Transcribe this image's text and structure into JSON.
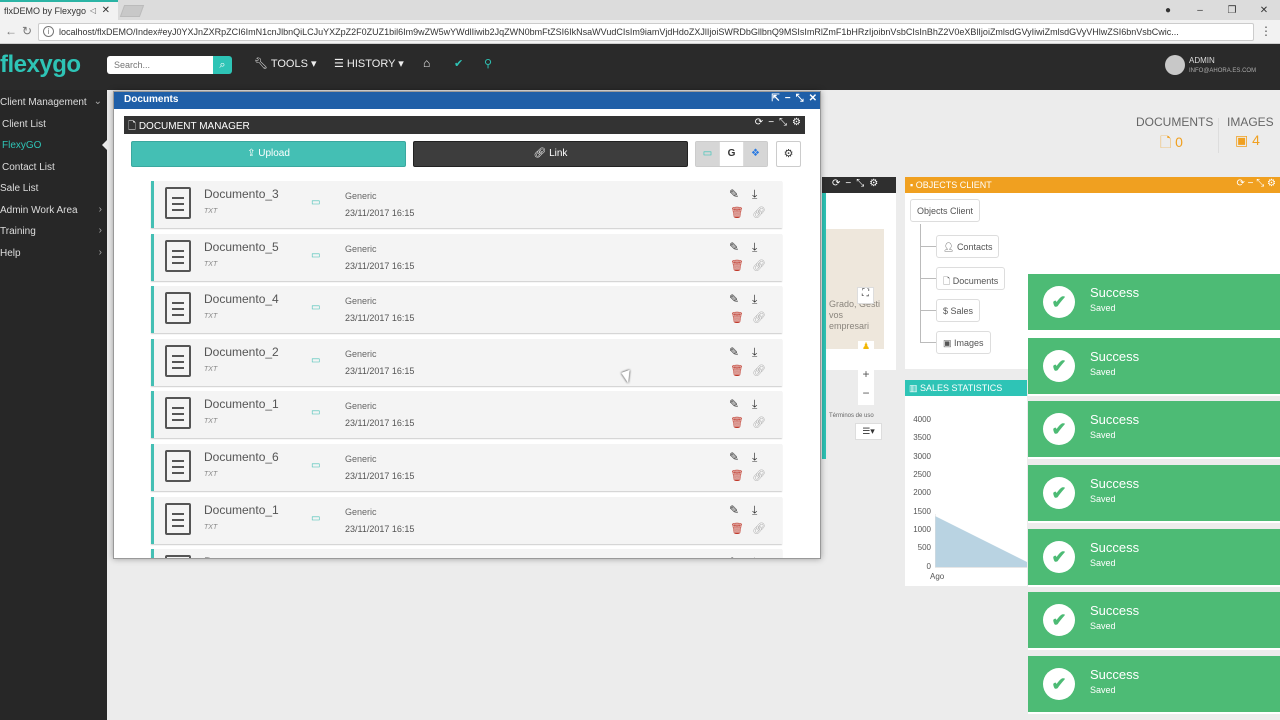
{
  "browser": {
    "tab_title": "flxDEMO by Flexygo",
    "url": "localhost/flxDEMO/Index#eyJ0YXJnZXRpZCI6ImN1cnJlbnQiLCJuYXZpZ2F0ZUZ1bil6Im9wZW5wYWdlIiwib2JqZWN0bmFtZSI6IkNsaWVudCIsIm9iamVjdHdoZXJlIjoiSWRDbGllbnQ9MSIsImRlZmF1bHRzIjoibnVsbCIsInBhZ2V0eXBlIjoiZmlsdGVyIiwiZmlsdGVyVHlwZSI6bnVsbCwic..."
  },
  "topbar": {
    "logo": "flexygo",
    "search_placeholder": "Search...",
    "tools_label": "TOOLS ▾",
    "history_label": "HISTORY ▾",
    "admin_name": "ADMIN",
    "admin_email": "INFO@AHORA.ES.COM"
  },
  "sidebar": {
    "items": [
      {
        "label": "Client Management"
      },
      {
        "label": "Client List"
      },
      {
        "label": "FlexyGO"
      },
      {
        "label": "Contact List"
      },
      {
        "label": "Sale List"
      },
      {
        "label": "Admin Work Area"
      },
      {
        "label": "Training"
      },
      {
        "label": "Help"
      }
    ]
  },
  "counters": {
    "documents_label": "DOCUMENTS",
    "documents_count": "0",
    "images_label": "IMAGES",
    "images_count": "4"
  },
  "map": {
    "text": "Grado, Gesti vos empresari",
    "terms": "Términos de uso"
  },
  "objects_client": {
    "title": "OBJECTS CLIENT",
    "root": "Objects Client",
    "children": [
      {
        "label": "Contacts"
      },
      {
        "label": "Documents"
      },
      {
        "label": "Sales"
      },
      {
        "label": "Images"
      }
    ]
  },
  "sales_statistics": {
    "title": "SALES STATISTICS",
    "y_ticks": [
      "4000",
      "3500",
      "3000",
      "2500",
      "2000",
      "1500",
      "1000",
      "500",
      "0"
    ],
    "x_label": "Ago"
  },
  "toasts": [
    {
      "title": "Success",
      "message": "Saved"
    },
    {
      "title": "Success",
      "message": "Saved"
    },
    {
      "title": "Success",
      "message": "Saved"
    },
    {
      "title": "Success",
      "message": "Saved"
    },
    {
      "title": "Success",
      "message": "Saved"
    },
    {
      "title": "Success",
      "message": "Saved"
    },
    {
      "title": "Success",
      "message": "Saved"
    }
  ],
  "modal": {
    "title": "Documents",
    "manager_title": "DOCUMENT MANAGER",
    "upload_label": "Upload",
    "link_label": "Link",
    "google_label": "G",
    "documents": [
      {
        "name": "Documento_3",
        "ext": "TXT",
        "category": "Generic",
        "date": "23/11/2017 16:15"
      },
      {
        "name": "Documento_5",
        "ext": "TXT",
        "category": "Generic",
        "date": "23/11/2017 16:15"
      },
      {
        "name": "Documento_4",
        "ext": "TXT",
        "category": "Generic",
        "date": "23/11/2017 16:15"
      },
      {
        "name": "Documento_2",
        "ext": "TXT",
        "category": "Generic",
        "date": "23/11/2017 16:15"
      },
      {
        "name": "Documento_1",
        "ext": "TXT",
        "category": "Generic",
        "date": "23/11/2017 16:15"
      },
      {
        "name": "Documento_6",
        "ext": "TXT",
        "category": "Generic",
        "date": "23/11/2017 16:15"
      },
      {
        "name": "Documento_1",
        "ext": "TXT",
        "category": "Generic",
        "date": "23/11/2017 16:15"
      },
      {
        "name": "Documento_",
        "ext": "",
        "category": "",
        "date": ""
      }
    ]
  },
  "colors": {
    "accent": "#2ec4b6",
    "modal_header": "#1f5fa8",
    "objects_header": "#f0a020",
    "toast": "#4dbb75",
    "delete": "#c0392b"
  }
}
